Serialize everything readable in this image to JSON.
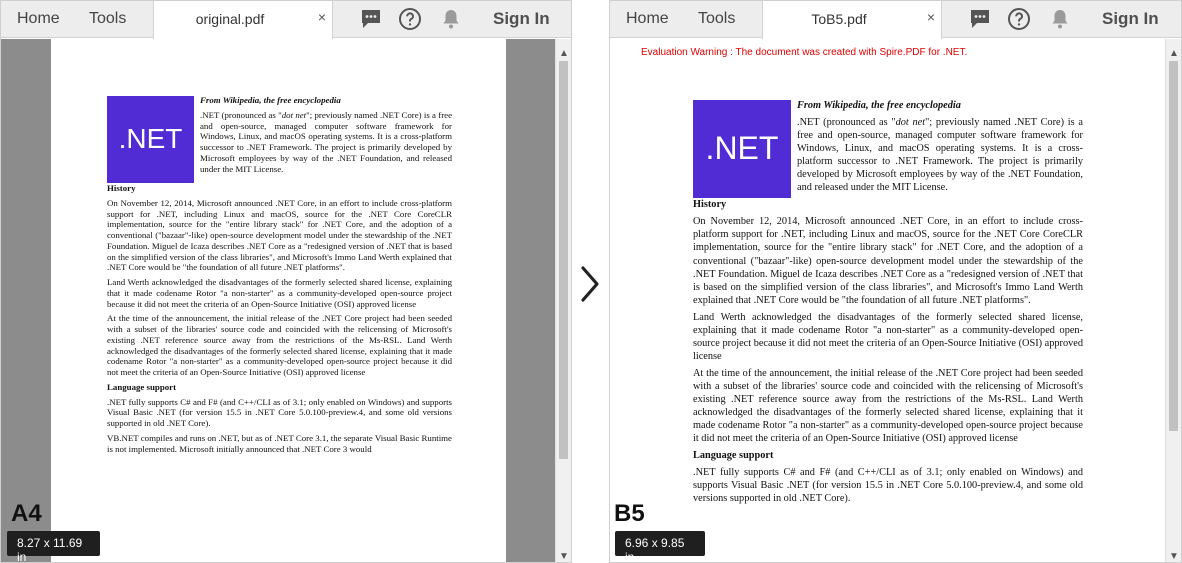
{
  "left_panel": {
    "toolbar": {
      "home": "Home",
      "tools": "Tools",
      "tab_name": "original.pdf",
      "close_glyph": "×",
      "sign_in": "Sign In",
      "icons": [
        "comment-icon",
        "help-icon",
        "bell-icon"
      ]
    },
    "doc": {
      "logo_text": ".NET",
      "source": "From Wikipedia, the free encyclopedia",
      "intro_a": ".NET (pronounced as \"",
      "intro_em": "dot net",
      "intro_b": "\"; previously named .NET Core) is a free and open-source, managed computer software framework for Windows, Linux, and macOS operating systems. It is a cross-platform successor to .NET Framework. The project is primarily developed by Microsoft employees by way of the .NET Foundation, and released under the MIT License.",
      "history_heading": "History",
      "history_p1": "On November 12, 2014, Microsoft announced .NET Core, in an effort to include cross-platform support for .NET, including Linux and macOS, source for the .NET Core CoreCLR implementation, source for the \"entire library stack\" for .NET Core, and the adoption of a conventional (\"bazaar\"-like) open-source development model under the stewardship of the .NET Foundation. Miguel de Icaza describes .NET Core as a \"redesigned version of .NET that is based on the simplified version of the class libraries\", and Microsoft's Immo Land Werth explained that .NET Core would be \"the foundation of all future .NET platforms\".",
      "history_p2": "Land Werth acknowledged the disadvantages of the formerly selected shared license, explaining that it made codename Rotor \"a non-starter\" as a community-developed open-source project because it did not meet the criteria of an Open-Source Initiative (OSI) approved license",
      "history_p3": "At the time of the announcement, the initial release of the .NET Core project had been seeded with a subset of the libraries' source code and coincided with the relicensing of Microsoft's existing .NET reference source away from the restrictions of the Ms-RSL. Land Werth acknowledged the disadvantages of the formerly selected shared license, explaining that it made codename Rotor \"a non-starter\" as a community-developed open-source project because it did not meet the criteria of an Open-Source Initiative (OSI) approved license",
      "lang_heading": "Language support",
      "lang_p1": ".NET fully supports C# and F# (and C++/CLI as of 3.1; only enabled on Windows) and supports Visual Basic .NET (for version 15.5 in .NET Core 5.0.100-preview.4, and some old versions supported in old .NET Core).",
      "lang_p2": "VB.NET compiles and runs on .NET, but as of .NET Core 3.1, the separate Visual Basic Runtime is not implemented. Microsoft initially announced that .NET Core 3 would"
    },
    "size_label": "A4",
    "dimensions": "8.27 x 11.69 in"
  },
  "right_panel": {
    "toolbar": {
      "home": "Home",
      "tools": "Tools",
      "tab_name": "ToB5.pdf",
      "close_glyph": "×",
      "sign_in": "Sign In",
      "icons": [
        "comment-icon",
        "help-icon",
        "bell-icon"
      ]
    },
    "eval_warning": "Evaluation Warning : The document was created with Spire.PDF for .NET.",
    "size_label": "B5",
    "dimensions": "6.96 x 9.85 in"
  },
  "scroll": {
    "up_glyph": "▲",
    "down_glyph": "▼"
  },
  "colors": {
    "dotnet_purple": "#512bd4",
    "warning_red": "#e00000"
  }
}
